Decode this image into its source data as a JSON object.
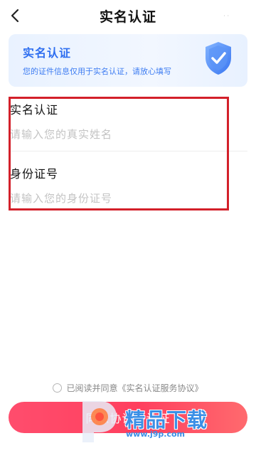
{
  "header": {
    "title": "实名认证"
  },
  "banner": {
    "title": "实名认证",
    "subtitle": "您的证件信息仅用于实名认证，请放心填写"
  },
  "form": {
    "name": {
      "label": "实名认证",
      "placeholder": "请输入您的真实姓名",
      "value": ""
    },
    "id_number": {
      "label": "身份证号",
      "placeholder": "请输入您的身份证号",
      "value": ""
    }
  },
  "agreement": {
    "text": "已阅读并同意《实名认证服务协议》",
    "checked": false
  },
  "submit": {
    "label": "同意协议并认证"
  },
  "watermark": {
    "brand": "精品下载",
    "url": "www.j9p.com"
  },
  "colors": {
    "accent": "#2f6ff0",
    "submit": "#ff4d6d",
    "highlight": "#d3202a",
    "watermark": "#3b8fe6"
  },
  "icons": {
    "back": "chevron-left-icon",
    "banner": "shield-check-icon"
  }
}
